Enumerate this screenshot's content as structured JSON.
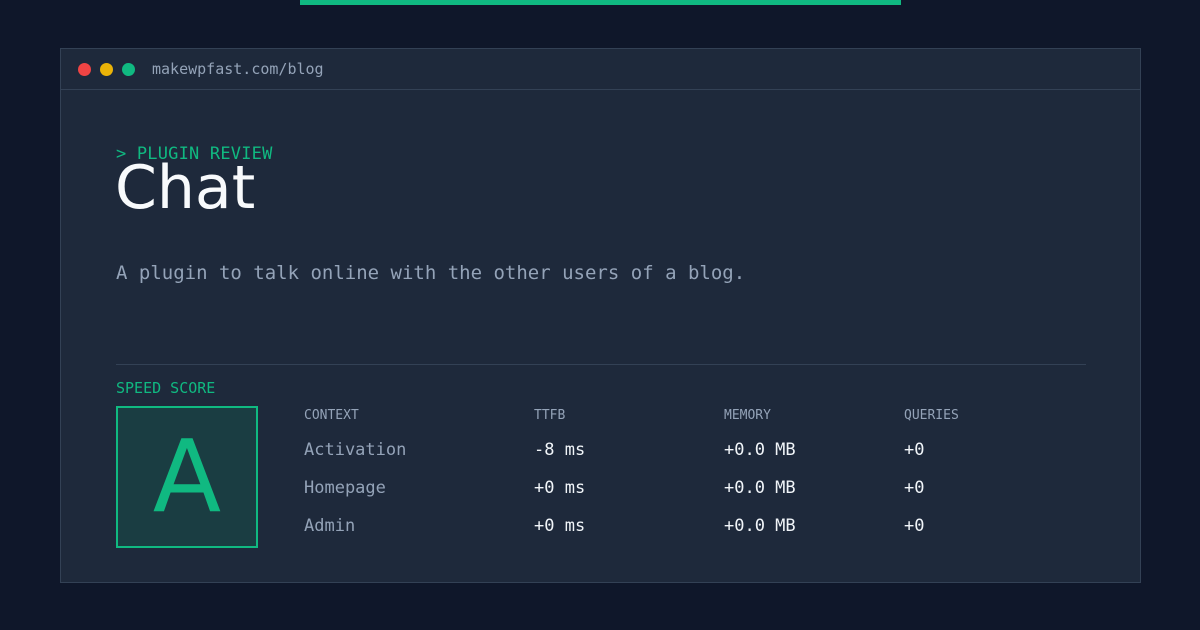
{
  "colors": {
    "accent": "#10b981",
    "background": "#0f172a",
    "window": "#1e293b",
    "muted": "#94a3b8",
    "text": "#f8fafc",
    "dot_red": "#ef4444",
    "dot_yellow": "#eab308",
    "dot_green": "#10b981"
  },
  "window": {
    "url": "makewpfast.com/blog",
    "controls": [
      "close-dot",
      "minimize-dot",
      "maximize-dot"
    ]
  },
  "header": {
    "eyebrow": "> PLUGIN REVIEW",
    "title": "Chat",
    "description": "A plugin to talk online with the other users of a blog."
  },
  "score": {
    "label": "SPEED SCORE",
    "grade": "A"
  },
  "metrics": {
    "columns": [
      "CONTEXT",
      "TTFB",
      "MEMORY",
      "QUERIES"
    ],
    "rows": [
      [
        "Activation",
        "-8 ms",
        "+0.0 MB",
        "+0"
      ],
      [
        "Homepage",
        "+0 ms",
        "+0.0 MB",
        "+0"
      ],
      [
        "Admin",
        "+0 ms",
        "+0.0 MB",
        "+0"
      ]
    ]
  }
}
